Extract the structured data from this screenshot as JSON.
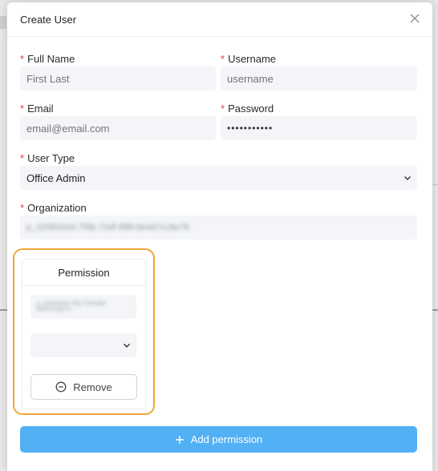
{
  "modal": {
    "title": "Create User"
  },
  "form": {
    "full_name": {
      "label": "Full Name",
      "placeholder": "First Last"
    },
    "username": {
      "label": "Username",
      "placeholder": "username"
    },
    "email": {
      "label": "Email",
      "placeholder": "email@email.com"
    },
    "password": {
      "label": "Password",
      "value": "•••••••••••"
    },
    "user_type": {
      "label": "User Type",
      "value": "Office Admin"
    },
    "organization": {
      "label": "Organization",
      "value": "p_029832e6-7f9b-72df-8f8f-8e4d7cc8e76"
    },
    "required_mark": "*"
  },
  "permission": {
    "title": "Permission",
    "org_value": "p_029832e6-7f9b-72df-8f8f-8e4d7cc8e76",
    "select_value": "",
    "remove_label": "Remove"
  },
  "actions": {
    "add_permission_label": "Add permission"
  },
  "colors": {
    "accent": "#52b0f5",
    "highlight": "#f0a53a",
    "required": "#e23b3b"
  },
  "icons": {
    "close": "close-icon",
    "chevron": "chevron-down-icon",
    "minus_circle": "minus-circle-icon",
    "plus": "plus-icon"
  }
}
